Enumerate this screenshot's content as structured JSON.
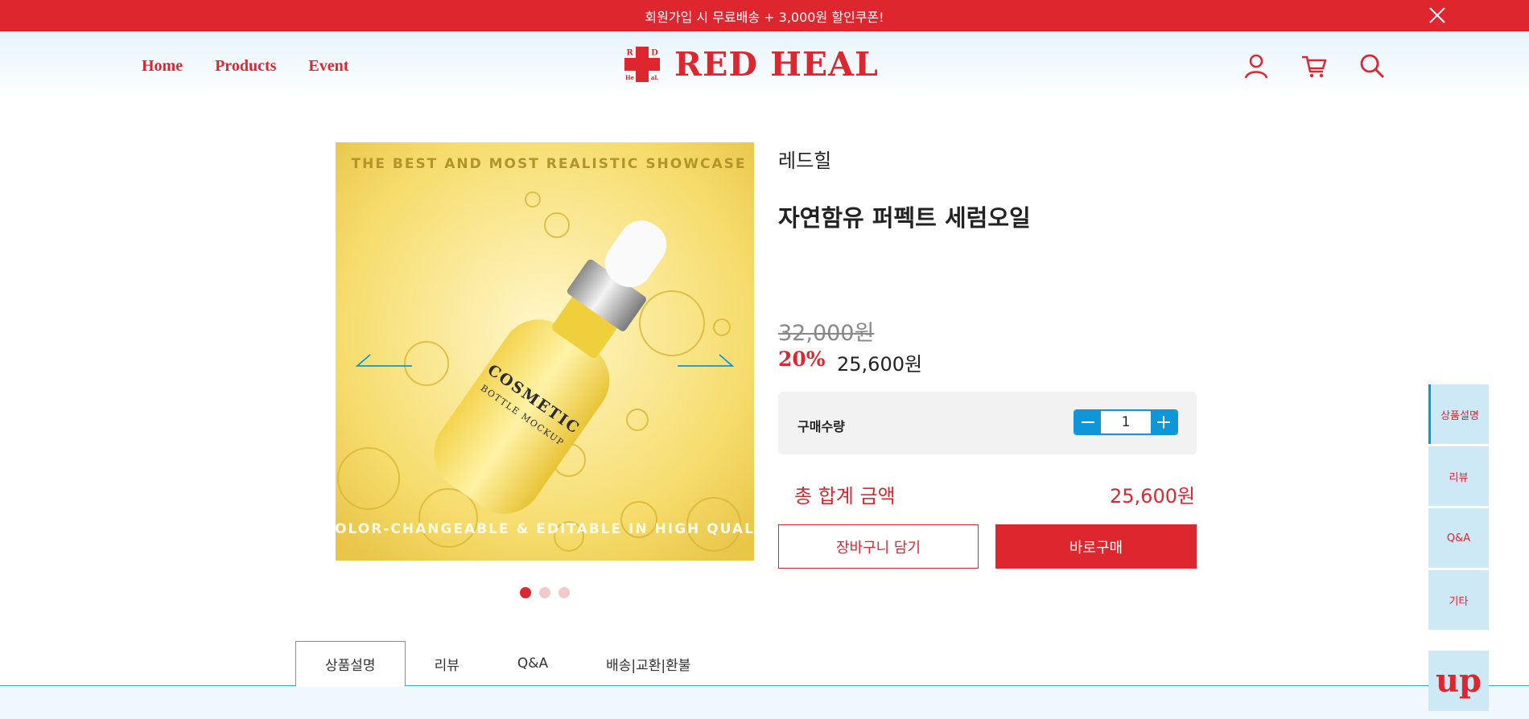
{
  "promo": {
    "text": "회원가입 시 무료배송 + 3,000원 할인쿠폰!",
    "close_icon": "close-icon"
  },
  "nav": {
    "items": [
      "Home",
      "Products",
      "Event"
    ]
  },
  "logo": {
    "text": "RED HEAL",
    "mark_letters": [
      "R",
      "D",
      "He",
      "aL"
    ]
  },
  "header_icons": [
    "user-icon",
    "cart-icon",
    "search-icon"
  ],
  "product": {
    "brand": "레드힐",
    "name": "자연함유 퍼펙트 세럼오일",
    "original_price": "32,000원",
    "discount": "20%",
    "sale_price": "25,600",
    "sale_currency": "원",
    "image_texts": {
      "top": "THE BEST AND MOST REALISTIC SHOWCASE",
      "bottom": "OLOR-CHANGEABLE & EDITABLE IN HIGH QUAL",
      "bottle_line1": "COSMETIC",
      "bottle_line2": "BOTTLE MOCKUP"
    },
    "slides": 3,
    "active_slide": 1
  },
  "quantity": {
    "label": "구매수량",
    "value": "1"
  },
  "total": {
    "label": "총 합계 금액",
    "value": "25,600원"
  },
  "buttons": {
    "cart": "장바구니 담기",
    "buy": "바로구매"
  },
  "tabs": [
    {
      "label": "상품설명",
      "active": true
    },
    {
      "label": "리뷰",
      "active": false
    },
    {
      "label": "Q&A",
      "active": false
    },
    {
      "label": "배송|교환|환불",
      "active": false
    }
  ],
  "side_nav": [
    {
      "label": "상품설명",
      "active": true
    },
    {
      "label": "리뷰",
      "active": false
    },
    {
      "label": "Q&A",
      "active": false
    },
    {
      "label": "기타",
      "active": false
    }
  ],
  "up_button": "up",
  "colors": {
    "brand_red": "#de262f",
    "accent_blue": "#0e96d8",
    "side_bg": "#cde9f6"
  }
}
